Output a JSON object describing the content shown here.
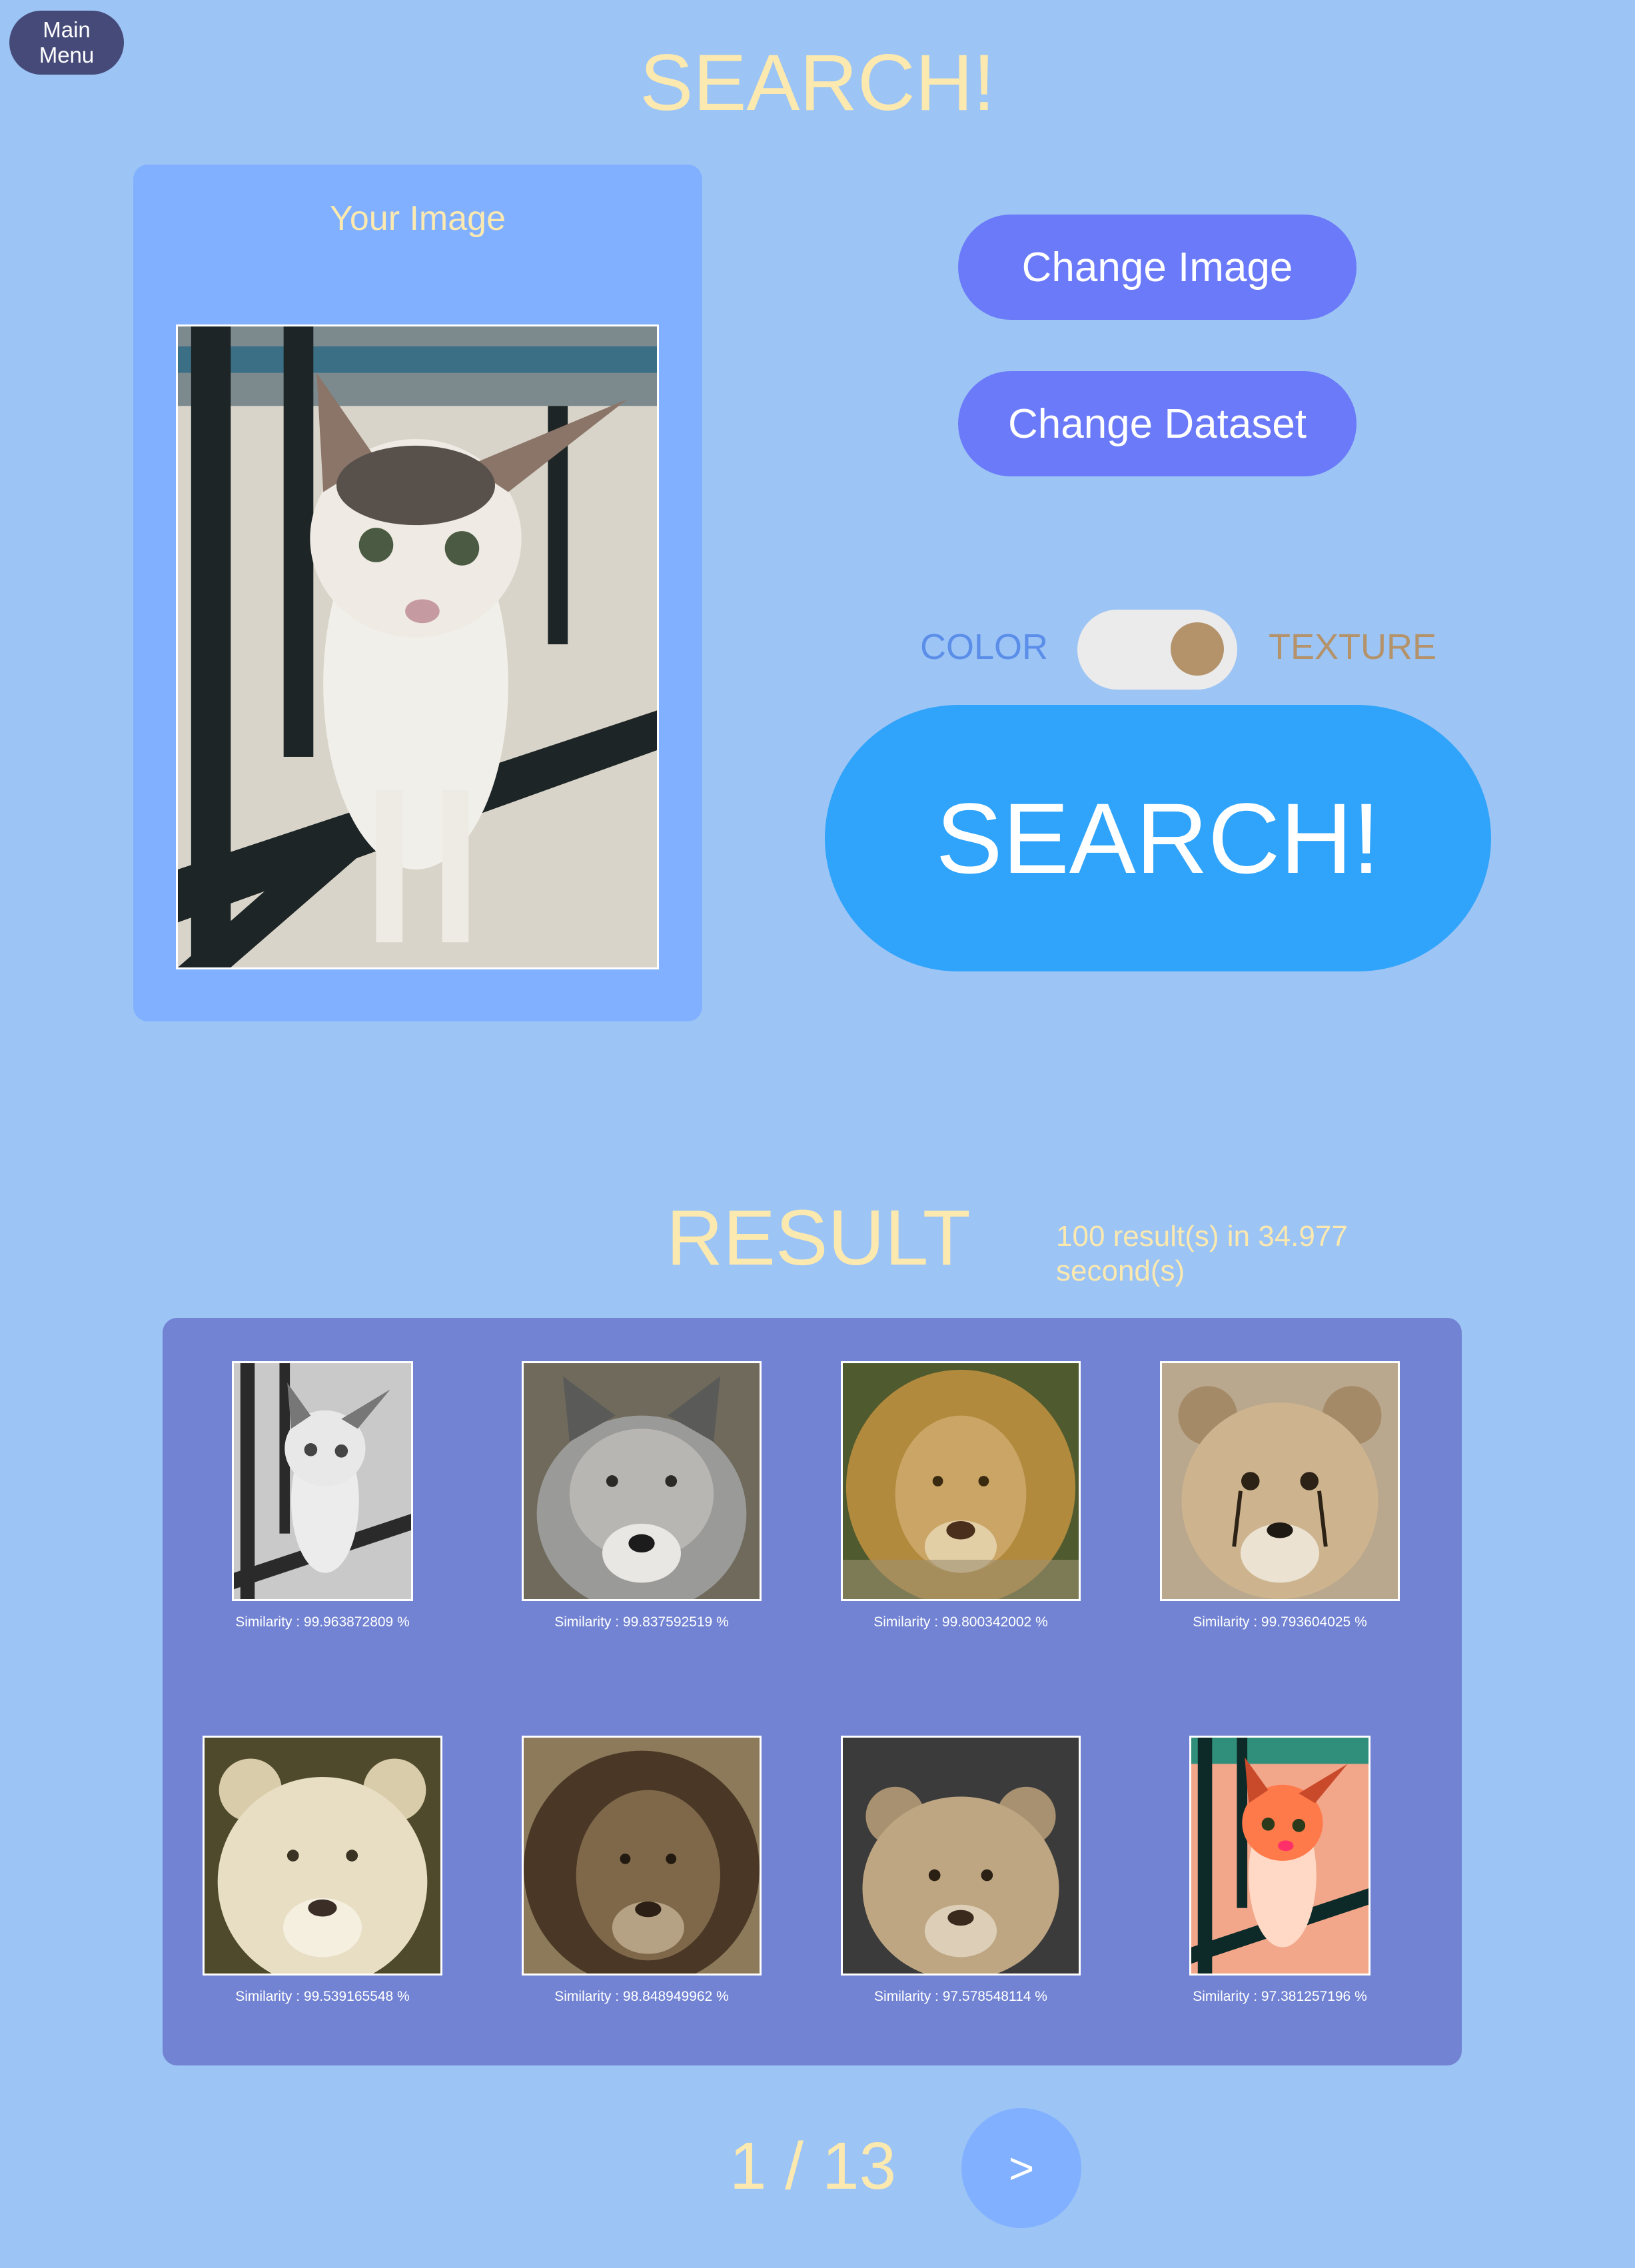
{
  "header": {
    "main_menu_label": "Main Menu",
    "title": "SEARCH!"
  },
  "upload_panel": {
    "title": "Your Image"
  },
  "controls": {
    "change_image_label": "Change Image",
    "change_dataset_label": "Change Dataset",
    "toggle_left_label": "COLOR",
    "toggle_right_label": "TEXTURE",
    "toggle_state": "TEXTURE",
    "search_label": "SEARCH!"
  },
  "results": {
    "title": "RESULT",
    "summary": "100 result(s) in 34.977 second(s)",
    "items": [
      {
        "caption": "Similarity : 99.963872809 %",
        "subject": "cat grayscale"
      },
      {
        "caption": "Similarity : 99.837592519 %",
        "subject": "wolf"
      },
      {
        "caption": "Similarity : 99.800342002 %",
        "subject": "lion"
      },
      {
        "caption": "Similarity : 99.793604025 %",
        "subject": "cheetah cub"
      },
      {
        "caption": "Similarity : 99.539165548 %",
        "subject": "white lioness"
      },
      {
        "caption": "Similarity : 98.848949962 %",
        "subject": "lion dark mane"
      },
      {
        "caption": "Similarity : 97.578548114 %",
        "subject": "lion cub"
      },
      {
        "caption": "Similarity : 97.381257196 %",
        "subject": "cat saturated"
      }
    ]
  },
  "pagination": {
    "indicator": "1 / 13",
    "next_label": ">"
  },
  "colors": {
    "background": "#9cc4f5",
    "title": "#fbe9b0",
    "button": "#6a7af8",
    "search_button": "#30a4fa",
    "result_panel": "#7283d3",
    "toggle_knob": "#b4926a"
  }
}
